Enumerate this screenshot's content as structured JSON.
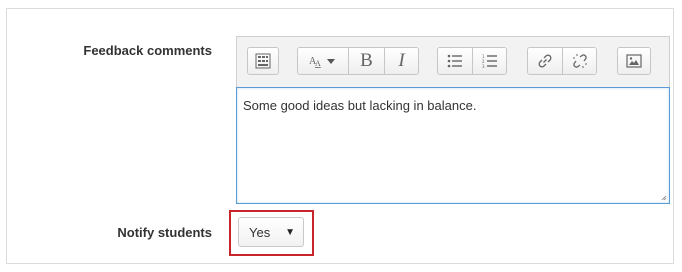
{
  "form": {
    "feedback_label": "Feedback comments",
    "notify_label": "Notify students"
  },
  "toolbar": {
    "buttons": [
      {
        "icon": "show-more-buttons-icon"
      },
      {
        "icon": "text-style-icon"
      },
      {
        "icon": "bold-icon",
        "text": "B"
      },
      {
        "icon": "italic-icon",
        "text": "I"
      },
      {
        "icon": "unordered-list-icon"
      },
      {
        "icon": "ordered-list-icon"
      },
      {
        "icon": "link-icon"
      },
      {
        "icon": "unlink-icon"
      },
      {
        "icon": "image-icon"
      }
    ]
  },
  "editor": {
    "content": "Some good ideas but lacking in balance."
  },
  "notify": {
    "selected": "Yes",
    "highlight_color": "#c8262b"
  },
  "colors": {
    "editor_focus_border": "#5b9bd5"
  }
}
